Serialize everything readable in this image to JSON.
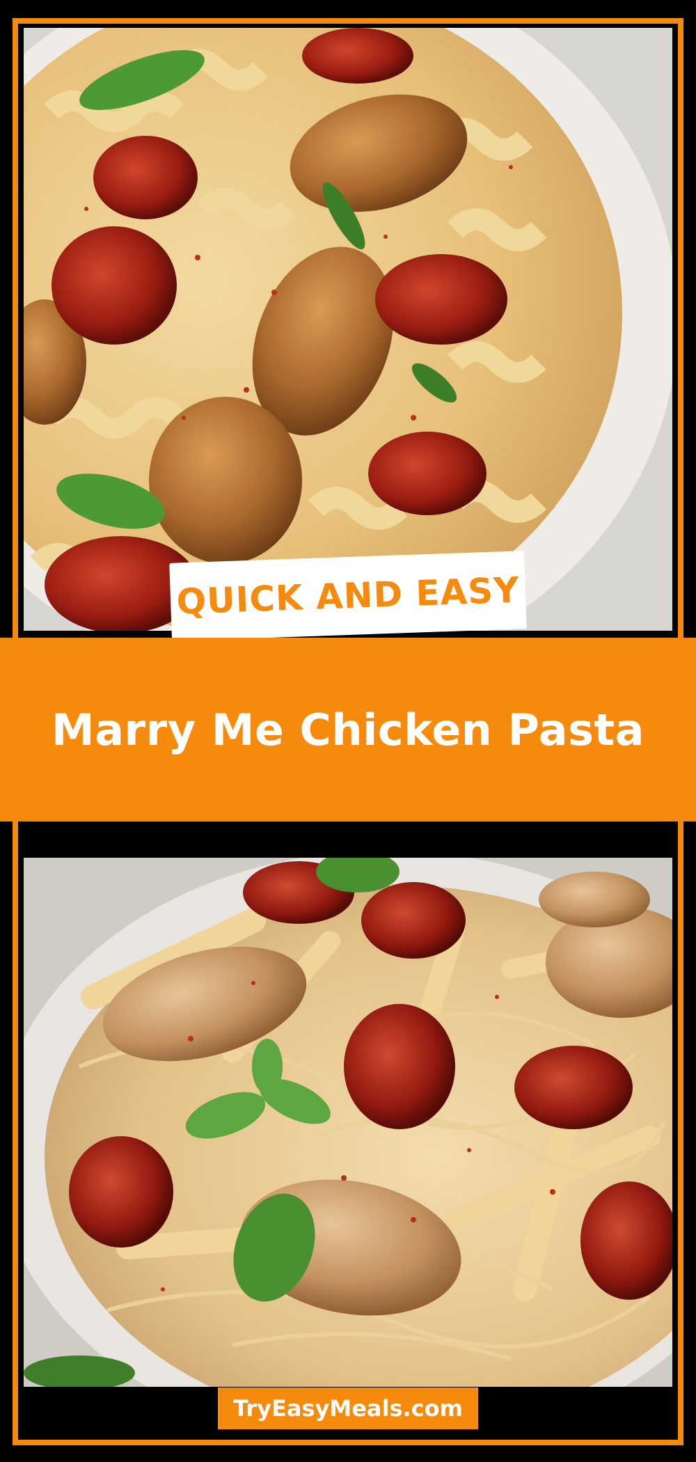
{
  "badge": {
    "text": "QUICK AND EASY"
  },
  "title": {
    "text": "Marry Me Chicken Pasta"
  },
  "footer": {
    "site": "TryEasyMeals.com"
  },
  "colors": {
    "accent": "#f58a0c",
    "background": "#000000",
    "text_light": "#ffffff"
  },
  "images": [
    {
      "name": "rotini-chicken-sun-dried-tomato-plate",
      "subject": "creamy rotini pasta with seared chicken, sun-dried tomatoes and basil"
    },
    {
      "name": "penne-chicken-sun-dried-tomato-bowl",
      "subject": "creamy penne pasta with seared chicken, sun-dried tomatoes and basil"
    }
  ]
}
